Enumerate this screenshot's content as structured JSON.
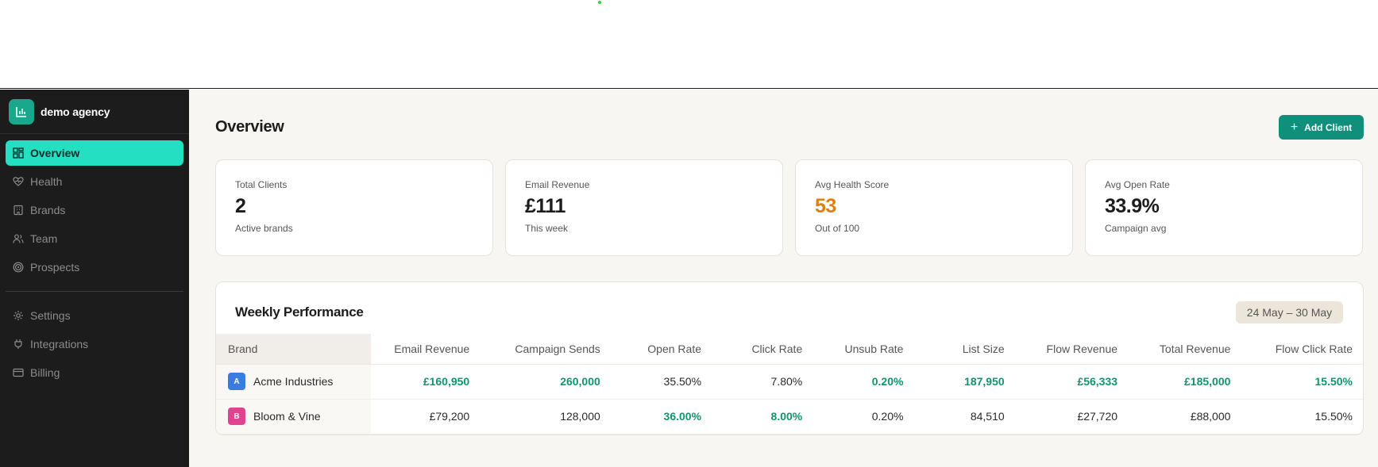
{
  "agency": {
    "name": "demo agency"
  },
  "nav": {
    "primary": [
      {
        "label": "Overview",
        "icon": "grid-icon",
        "active": true
      },
      {
        "label": "Health",
        "icon": "heart-pulse-icon"
      },
      {
        "label": "Brands",
        "icon": "building-icon"
      },
      {
        "label": "Team",
        "icon": "users-icon"
      },
      {
        "label": "Prospects",
        "icon": "target-icon"
      }
    ],
    "secondary": [
      {
        "label": "Settings",
        "icon": "gear-icon"
      },
      {
        "label": "Integrations",
        "icon": "plug-icon"
      },
      {
        "label": "Billing",
        "icon": "credit-card-icon"
      }
    ]
  },
  "header": {
    "title": "Overview",
    "add_button": "Add Client"
  },
  "stats": [
    {
      "label": "Total Clients",
      "value": "2",
      "sub": "Active brands"
    },
    {
      "label": "Email Revenue",
      "value": "£111",
      "sub": "This week"
    },
    {
      "label": "Avg Health Score",
      "value": "53",
      "sub": "Out of 100",
      "color": "#d9820f"
    },
    {
      "label": "Avg Open Rate",
      "value": "33.9%",
      "sub": "Campaign avg"
    }
  ],
  "performance": {
    "title": "Weekly Performance",
    "date_range": "24 May – 30 May",
    "columns": [
      "Brand",
      "Email Revenue",
      "Campaign Sends",
      "Open Rate",
      "Click Rate",
      "Unsub Rate",
      "List Size",
      "Flow Revenue",
      "Total Revenue",
      "Flow Click Rate"
    ],
    "rows": [
      {
        "initial": "A",
        "avatar_color": "#3b7be0",
        "brand": "Acme Industries",
        "cells": [
          "£160,950",
          "260,000",
          "35.50%",
          "7.80%",
          "0.20%",
          "187,950",
          "£56,333",
          "£185,000",
          "15.50%"
        ],
        "highlight": [
          true,
          true,
          false,
          false,
          true,
          true,
          true,
          true,
          true
        ]
      },
      {
        "initial": "B",
        "avatar_color": "#e0438f",
        "brand": "Bloom & Vine",
        "cells": [
          "£79,200",
          "128,000",
          "36.00%",
          "8.00%",
          "0.20%",
          "84,510",
          "£27,720",
          "£88,000",
          "15.50%"
        ],
        "highlight": [
          false,
          false,
          true,
          true,
          false,
          false,
          false,
          false,
          false
        ]
      }
    ]
  },
  "colors": {
    "accent": "#24dfc2",
    "button": "#0f8f7c",
    "positive": "#12936f",
    "warning": "#d9820f"
  }
}
